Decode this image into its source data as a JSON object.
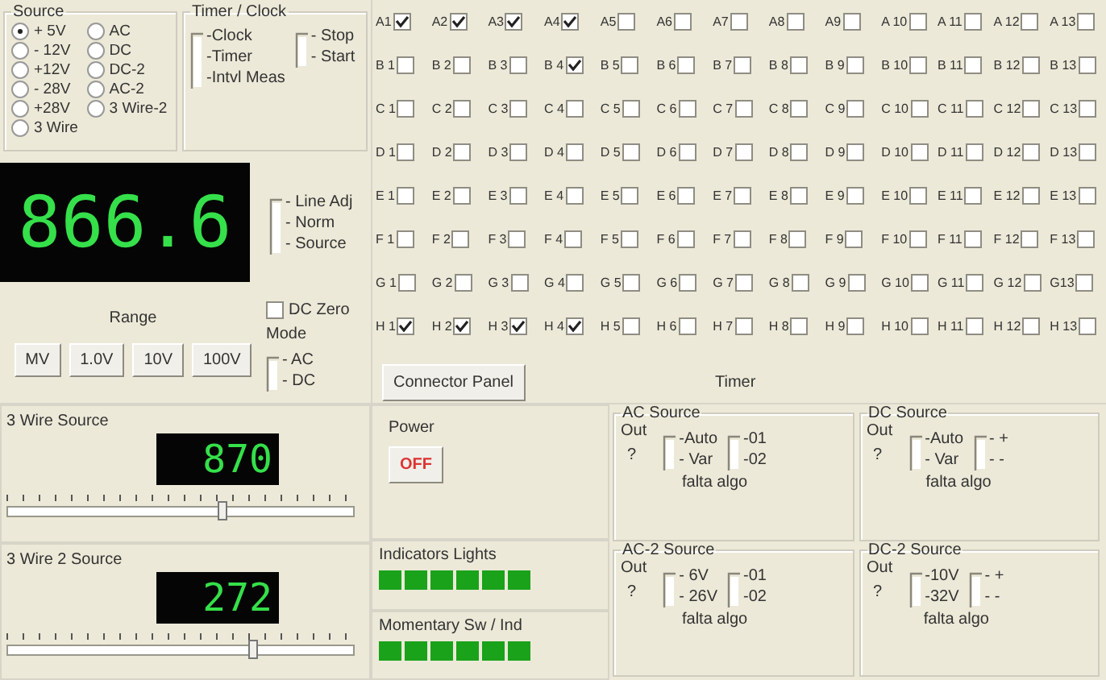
{
  "source": {
    "title": "Source",
    "options": [
      {
        "label": "+ 5V",
        "selected": true
      },
      {
        "label": "- 12V",
        "selected": false
      },
      {
        "label": "+12V",
        "selected": false
      },
      {
        "label": "- 28V",
        "selected": false
      },
      {
        "label": "+28V",
        "selected": false
      },
      {
        "label": "3 Wire",
        "selected": false
      },
      {
        "label": "AC",
        "selected": false
      },
      {
        "label": "DC",
        "selected": false
      },
      {
        "label": "DC-2",
        "selected": false
      },
      {
        "label": "AC-2",
        "selected": false
      },
      {
        "label": "3 Wire-2",
        "selected": false
      }
    ]
  },
  "timer_clock": {
    "title": "Timer / Clock",
    "switches": [
      [
        "-Clock",
        "-Timer",
        "-Intvl Meas"
      ],
      [
        "- Stop",
        "- Start"
      ]
    ]
  },
  "display": {
    "reading": "866.6"
  },
  "input_switch": [
    "- Line Adj",
    "- Norm",
    "- Source"
  ],
  "range": {
    "label": "Range",
    "buttons": [
      "MV",
      "1.0V",
      "10V",
      "100V"
    ]
  },
  "dc_zero": {
    "label": "DC Zero",
    "checked": false
  },
  "mode": {
    "label": "Mode",
    "switch": [
      "- AC",
      "- DC"
    ]
  },
  "connector_grid": {
    "rows": [
      {
        "cells": [
          {
            "label": "A1",
            "checked": true
          },
          {
            "label": "A2",
            "checked": true
          },
          {
            "label": "A3",
            "checked": true
          },
          {
            "label": "A4",
            "checked": true
          },
          {
            "label": "A5",
            "checked": false
          },
          {
            "label": "A6",
            "checked": false
          },
          {
            "label": "A7",
            "checked": false
          },
          {
            "label": "A8",
            "checked": false
          },
          {
            "label": "A9",
            "checked": false
          },
          {
            "label": "A 10",
            "checked": false
          },
          {
            "label": "A 11",
            "checked": false
          },
          {
            "label": "A 12",
            "checked": false
          },
          {
            "label": "A 13",
            "checked": false
          }
        ]
      },
      {
        "cells": [
          {
            "label": "B 1",
            "checked": false
          },
          {
            "label": "B 2",
            "checked": false
          },
          {
            "label": "B 3",
            "checked": false
          },
          {
            "label": "B 4",
            "checked": true
          },
          {
            "label": "B 5",
            "checked": false
          },
          {
            "label": "B 6",
            "checked": false
          },
          {
            "label": "B 7",
            "checked": false
          },
          {
            "label": "B 8",
            "checked": false
          },
          {
            "label": "B 9",
            "checked": false
          },
          {
            "label": "B 10",
            "checked": false
          },
          {
            "label": "B 11",
            "checked": false
          },
          {
            "label": "B 12",
            "checked": false
          },
          {
            "label": "B 13",
            "checked": false
          }
        ]
      },
      {
        "cells": [
          {
            "label": "C 1",
            "checked": false
          },
          {
            "label": "C 2",
            "checked": false
          },
          {
            "label": "C 3",
            "checked": false
          },
          {
            "label": "C 4",
            "checked": false
          },
          {
            "label": "C 5",
            "checked": false
          },
          {
            "label": "C 6",
            "checked": false
          },
          {
            "label": "C 7",
            "checked": false
          },
          {
            "label": "C 8",
            "checked": false
          },
          {
            "label": "C 9",
            "checked": false
          },
          {
            "label": "C 10",
            "checked": false
          },
          {
            "label": "C 11",
            "checked": false
          },
          {
            "label": "C 12",
            "checked": false
          },
          {
            "label": "C 13",
            "checked": false
          }
        ]
      },
      {
        "cells": [
          {
            "label": "D 1",
            "checked": false
          },
          {
            "label": "D 2",
            "checked": false
          },
          {
            "label": "D 3",
            "checked": false
          },
          {
            "label": "D 4",
            "checked": false
          },
          {
            "label": "D 5",
            "checked": false
          },
          {
            "label": "D 6",
            "checked": false
          },
          {
            "label": "D 7",
            "checked": false
          },
          {
            "label": "D 8",
            "checked": false
          },
          {
            "label": "D 9",
            "checked": false
          },
          {
            "label": "D 10",
            "checked": false
          },
          {
            "label": "D 11",
            "checked": false
          },
          {
            "label": "D 12",
            "checked": false
          },
          {
            "label": "D 13",
            "checked": false
          }
        ]
      },
      {
        "cells": [
          {
            "label": "E 1",
            "checked": false
          },
          {
            "label": "E 2",
            "checked": false
          },
          {
            "label": "E 3",
            "checked": false
          },
          {
            "label": "E 4",
            "checked": false
          },
          {
            "label": "E 5",
            "checked": false
          },
          {
            "label": "E 6",
            "checked": false
          },
          {
            "label": "E 7",
            "checked": false
          },
          {
            "label": "E 8",
            "checked": false
          },
          {
            "label": "E 9",
            "checked": false
          },
          {
            "label": "E 10",
            "checked": false
          },
          {
            "label": "E 11",
            "checked": false
          },
          {
            "label": "E 12",
            "checked": false
          },
          {
            "label": "E 13",
            "checked": false
          }
        ]
      },
      {
        "cells": [
          {
            "label": "F 1",
            "checked": false
          },
          {
            "label": "F 2",
            "checked": false
          },
          {
            "label": "F 3",
            "checked": false
          },
          {
            "label": "F 4",
            "checked": false
          },
          {
            "label": "F 5",
            "checked": false
          },
          {
            "label": "F 6",
            "checked": false
          },
          {
            "label": "F 7",
            "checked": false
          },
          {
            "label": "F 8",
            "checked": false
          },
          {
            "label": "F 9",
            "checked": false
          },
          {
            "label": "F 10",
            "checked": false
          },
          {
            "label": "F 11",
            "checked": false
          },
          {
            "label": "F 12",
            "checked": false
          },
          {
            "label": "F 13",
            "checked": false
          }
        ]
      },
      {
        "cells": [
          {
            "label": "G 1",
            "checked": false
          },
          {
            "label": "G 2",
            "checked": false
          },
          {
            "label": "G 3",
            "checked": false
          },
          {
            "label": "G 4",
            "checked": false
          },
          {
            "label": "G 5",
            "checked": false
          },
          {
            "label": "G 6",
            "checked": false
          },
          {
            "label": "G 7",
            "checked": false
          },
          {
            "label": "G 8",
            "checked": false
          },
          {
            "label": "G 9",
            "checked": false
          },
          {
            "label": "G 10",
            "checked": false
          },
          {
            "label": "G 11",
            "checked": false
          },
          {
            "label": "G 12",
            "checked": false
          },
          {
            "label": "G13",
            "checked": false
          }
        ]
      },
      {
        "cells": [
          {
            "label": "H 1",
            "checked": true
          },
          {
            "label": "H 2",
            "checked": true
          },
          {
            "label": "H 3",
            "checked": true
          },
          {
            "label": "H 4",
            "checked": true
          },
          {
            "label": "H 5",
            "checked": false
          },
          {
            "label": "H 6",
            "checked": false
          },
          {
            "label": "H 7",
            "checked": false
          },
          {
            "label": "H 8",
            "checked": false
          },
          {
            "label": "H 9",
            "checked": false
          },
          {
            "label": "H 10",
            "checked": false
          },
          {
            "label": "H 11",
            "checked": false
          },
          {
            "label": "H 12",
            "checked": false
          },
          {
            "label": "H 13",
            "checked": false
          }
        ]
      }
    ]
  },
  "connector_button": "Connector Panel",
  "timer_label": "Timer",
  "wire_sources": [
    {
      "title": "3 Wire Source",
      "reading": "870",
      "level": 0.62
    },
    {
      "title": "3 Wire 2 Source",
      "reading": "272",
      "level": 0.71
    }
  ],
  "power": {
    "label": "Power",
    "button": "OFF",
    "on": false
  },
  "indicator_lights": {
    "title": "Indicators Lights",
    "lights": [
      {
        "on": true
      },
      {
        "on": true
      },
      {
        "on": true
      },
      {
        "on": true
      },
      {
        "on": true
      },
      {
        "on": true
      }
    ]
  },
  "momentary": {
    "title": "Momentary Sw / Ind",
    "lights": [
      {
        "on": true
      },
      {
        "on": true
      },
      {
        "on": true
      },
      {
        "on": true
      },
      {
        "on": true
      },
      {
        "on": true
      }
    ]
  },
  "source_panels": [
    {
      "title": "AC Source",
      "out": "Out",
      "value": "?",
      "switches": [
        [
          "-Auto",
          "- Var"
        ],
        [
          "-01",
          "-02"
        ]
      ],
      "note": "falta algo"
    },
    {
      "title": "DC Source",
      "out": "Out",
      "value": "?",
      "switches": [
        [
          "-Auto",
          "- Var"
        ],
        [
          "- +",
          "- -"
        ]
      ],
      "note": "falta algo"
    },
    {
      "title": "AC-2 Source",
      "out": "Out",
      "value": "?",
      "switches": [
        [
          "- 6V",
          "- 26V"
        ],
        [
          "-01",
          "-02"
        ]
      ],
      "note": "falta algo"
    },
    {
      "title": "DC-2 Source",
      "out": "Out",
      "value": "?",
      "switches": [
        [
          "-10V",
          "-32V"
        ],
        [
          "- +",
          "- -"
        ]
      ],
      "note": "falta algo"
    }
  ]
}
